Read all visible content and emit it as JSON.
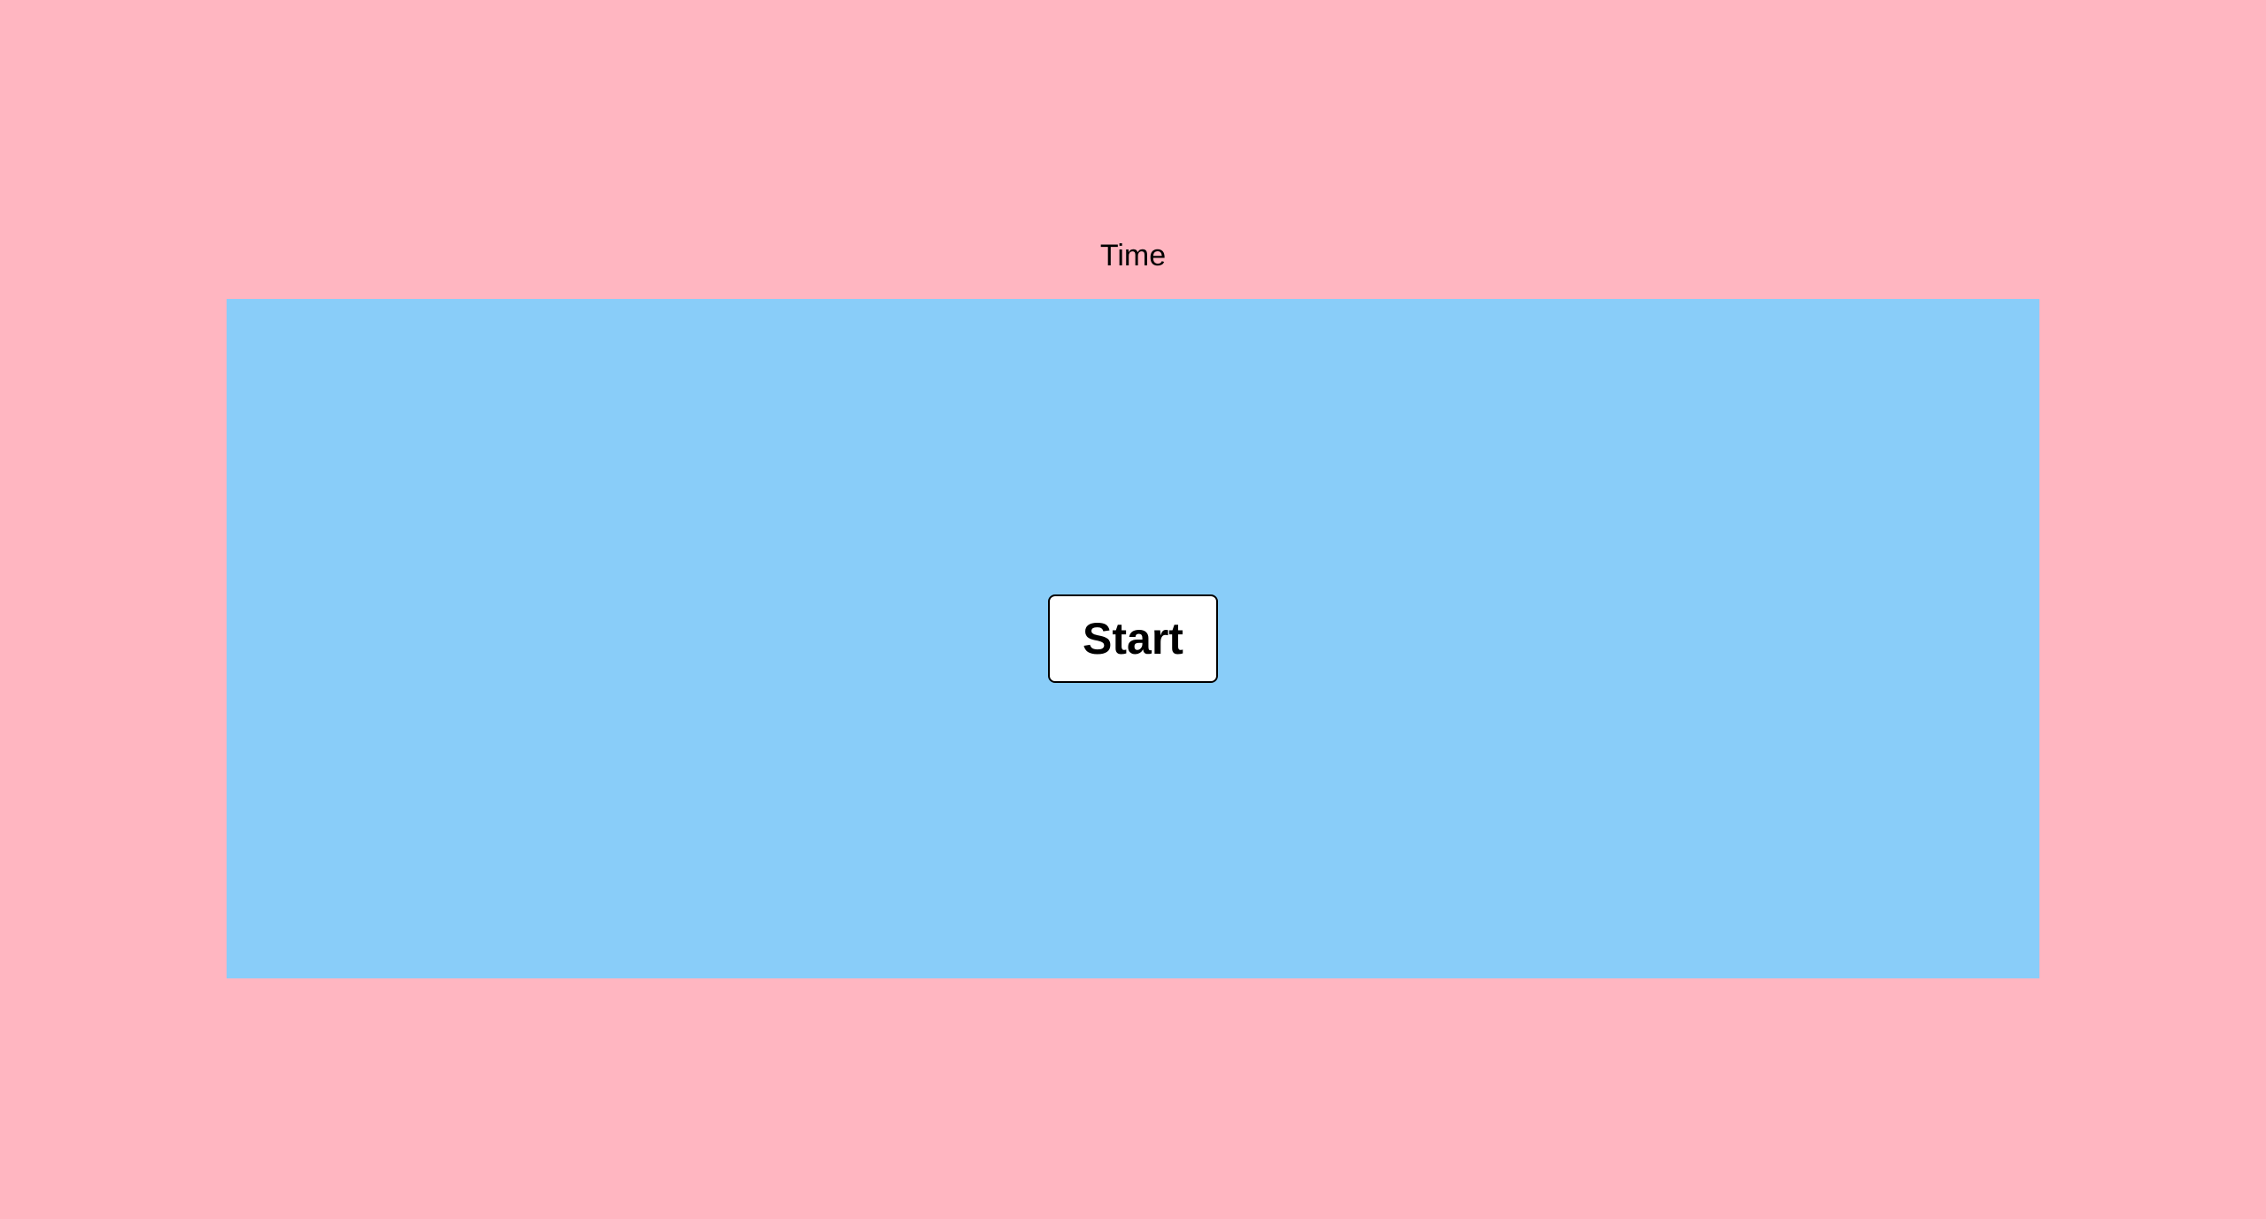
{
  "header": {
    "timer_label": "Time"
  },
  "game": {
    "start_label": "Start"
  },
  "colors": {
    "page_background": "#ffb6c1",
    "game_area_background": "#89cdf9",
    "button_background": "#ffffff",
    "text": "#000000"
  }
}
